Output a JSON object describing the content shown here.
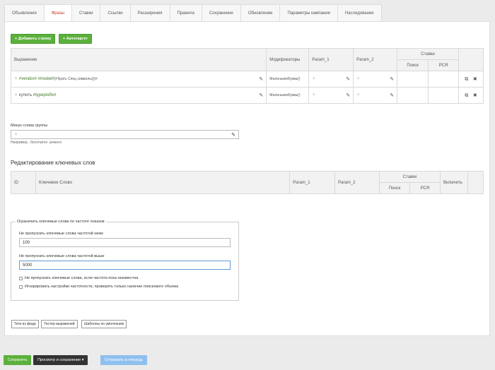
{
  "tabs": [
    "Объявления",
    "Фразы",
    "Ставки",
    "Ссылки",
    "Расширения",
    "Правила",
    "Сохранение",
    "Обновление",
    "Параметры кампании",
    "Наследование"
  ],
  "active_tab": "Фразы",
  "phrases": {
    "add_row_button": "+ Добавить строку",
    "autotarget_button": "+ Автотаргет",
    "headers": {
      "expression": "Выражение",
      "modifiers": "Модификаторы",
      "param1": "Param_1",
      "param2": "Param_2",
      "bids": "Ставки",
      "search": "Поиск",
      "rsya": "РСЯ"
    },
    "rows": [
      {
        "expr_green": "#vendor# #model#",
        "expr_dark": "{Убрать Спец символы()}#",
        "modifiers": "МаленькиеБуквы()"
      },
      {
        "expr_dark": "купить ",
        "expr_green": "#typeprefix#",
        "modifiers": "МаленькиеБуквы()"
      }
    ]
  },
  "minus_words": {
    "label": "Минус-слова группы",
    "hint": "Например, -бесплатно -ремонт."
  },
  "keywords_edit": {
    "title": "Редактирование ключевых слов",
    "headers": {
      "id": "ID",
      "keyword": "Ключевое Слово",
      "param1": "Param_1",
      "param2": "Param_2",
      "bids": "Ставки",
      "search": "Поиск",
      "rsya": "РСЯ",
      "enable": "Включить"
    }
  },
  "frequency": {
    "legend": "Ограничить ключевые слова по частоте показов",
    "low_label": "Не пропускать ключевые слова частотой ниже",
    "low_value": "100",
    "high_label": "Не пропускать ключевые слова частотой выше",
    "high_value": "5000",
    "check1": "Не пропускать ключевые слова, если частота пока неизвестна",
    "check2": "Игнорировать настройки частотности, проверять только наличие поискового объема"
  },
  "small_buttons": [
    "Теги из фида",
    "Тестер выражений",
    "Шаблоны по умолчанию"
  ],
  "footer": {
    "save": "Сохранить",
    "preview_save": "Просмотр и сохранение ▾",
    "queue": "Отправить в очередь"
  },
  "colors": {
    "green": "#5cb03c",
    "dark": "#333333",
    "light_blue": "#8ec0ee",
    "active_tab": "#c0392b"
  }
}
